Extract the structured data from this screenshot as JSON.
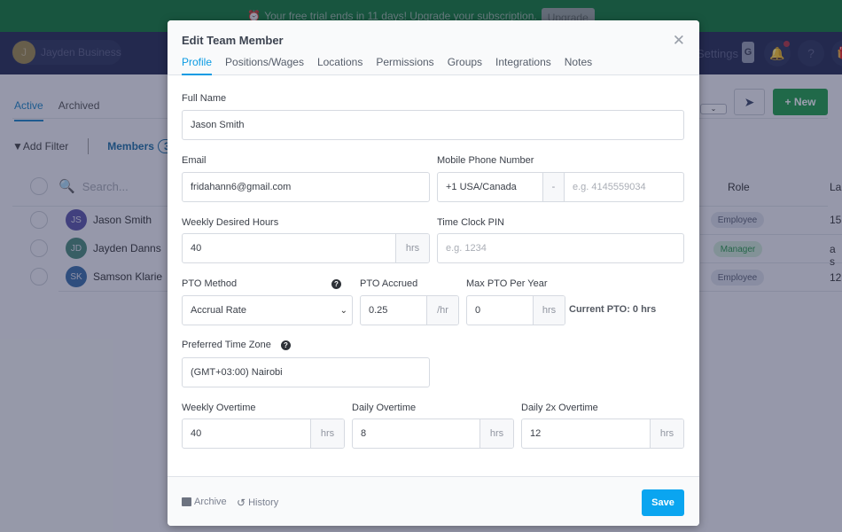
{
  "banner": {
    "icon": "alarm-clock-icon",
    "message": "Your free trial ends in 11 days! Upgrade your subscription.",
    "upgrade_label": "Upgrade"
  },
  "topnav": {
    "business_initial": "J",
    "business_name": "Jayden Business",
    "settings_label": "Settings",
    "g_label": "G",
    "icons": [
      "bell-icon",
      "help-icon",
      "gift-icon"
    ]
  },
  "page": {
    "tabs": [
      {
        "label": "Active",
        "active": true
      },
      {
        "label": "Archived",
        "active": false
      }
    ],
    "add_filter_label": "Add Filter",
    "members_label": "Members",
    "members_count": "3",
    "search_placeholder": "Search...",
    "new_label": "New",
    "columns": {
      "role": "Role",
      "last": "La"
    },
    "rows": [
      {
        "initials": "JS",
        "name": "Jason Smith",
        "avatar_color": "#5a55a8",
        "role": "Employee",
        "last": "15"
      },
      {
        "initials": "JD",
        "name": "Jayden Danns",
        "avatar_color": "#4a8a78",
        "role": "Manager",
        "last": "a s"
      },
      {
        "initials": "SK",
        "name": "Samson Klarie",
        "avatar_color": "#3a6ea8",
        "role": "Employee",
        "last": "12"
      }
    ]
  },
  "modal": {
    "title": "Edit Team Member",
    "close_icon": "close-icon",
    "tabs": [
      {
        "label": "Profile",
        "active": true
      },
      {
        "label": "Positions/Wages",
        "active": false
      },
      {
        "label": "Locations",
        "active": false
      },
      {
        "label": "Permissions",
        "active": false
      },
      {
        "label": "Groups",
        "active": false
      },
      {
        "label": "Integrations",
        "active": false
      },
      {
        "label": "Notes",
        "active": false
      }
    ],
    "fields": {
      "full_name": {
        "label": "Full Name",
        "value": "Jason Smith"
      },
      "email": {
        "label": "Email",
        "value": "fridahann6@gmail.com"
      },
      "mobile": {
        "label": "Mobile Phone Number",
        "country": "+1 USA/Canada",
        "separator": "-",
        "placeholder": "e.g. 4145559034"
      },
      "weekly_desired": {
        "label": "Weekly Desired Hours",
        "value": "40",
        "unit": "hrs"
      },
      "time_clock_pin": {
        "label": "Time Clock PIN",
        "placeholder": "e.g. 1234"
      },
      "pto_method": {
        "label": "PTO Method",
        "value": "Accrual Rate"
      },
      "pto_accrued": {
        "label": "PTO Accrued",
        "value": "0.25",
        "unit": "/hr"
      },
      "max_pto": {
        "label": "Max PTO Per Year",
        "value": "0",
        "unit": "hrs"
      },
      "current_pto": "Current PTO: 0 hrs",
      "time_zone": {
        "label": "Preferred Time Zone",
        "value": "(GMT+03:00) Nairobi"
      },
      "weekly_overtime": {
        "label": "Weekly Overtime",
        "value": "40",
        "unit": "hrs"
      },
      "daily_overtime": {
        "label": "Daily Overtime",
        "value": "8",
        "unit": "hrs"
      },
      "daily_2x_overtime": {
        "label": "Daily 2x Overtime",
        "value": "12",
        "unit": "hrs"
      }
    },
    "footer": {
      "archive_label": "Archive",
      "history_label": "History",
      "save_label": "Save"
    }
  },
  "colors": {
    "banner_green": "#0f7a36",
    "nav_navy": "#232a50",
    "accent_blue": "#0b9be3",
    "save_blue": "#0aa5f0",
    "new_green": "#1e9e48"
  }
}
